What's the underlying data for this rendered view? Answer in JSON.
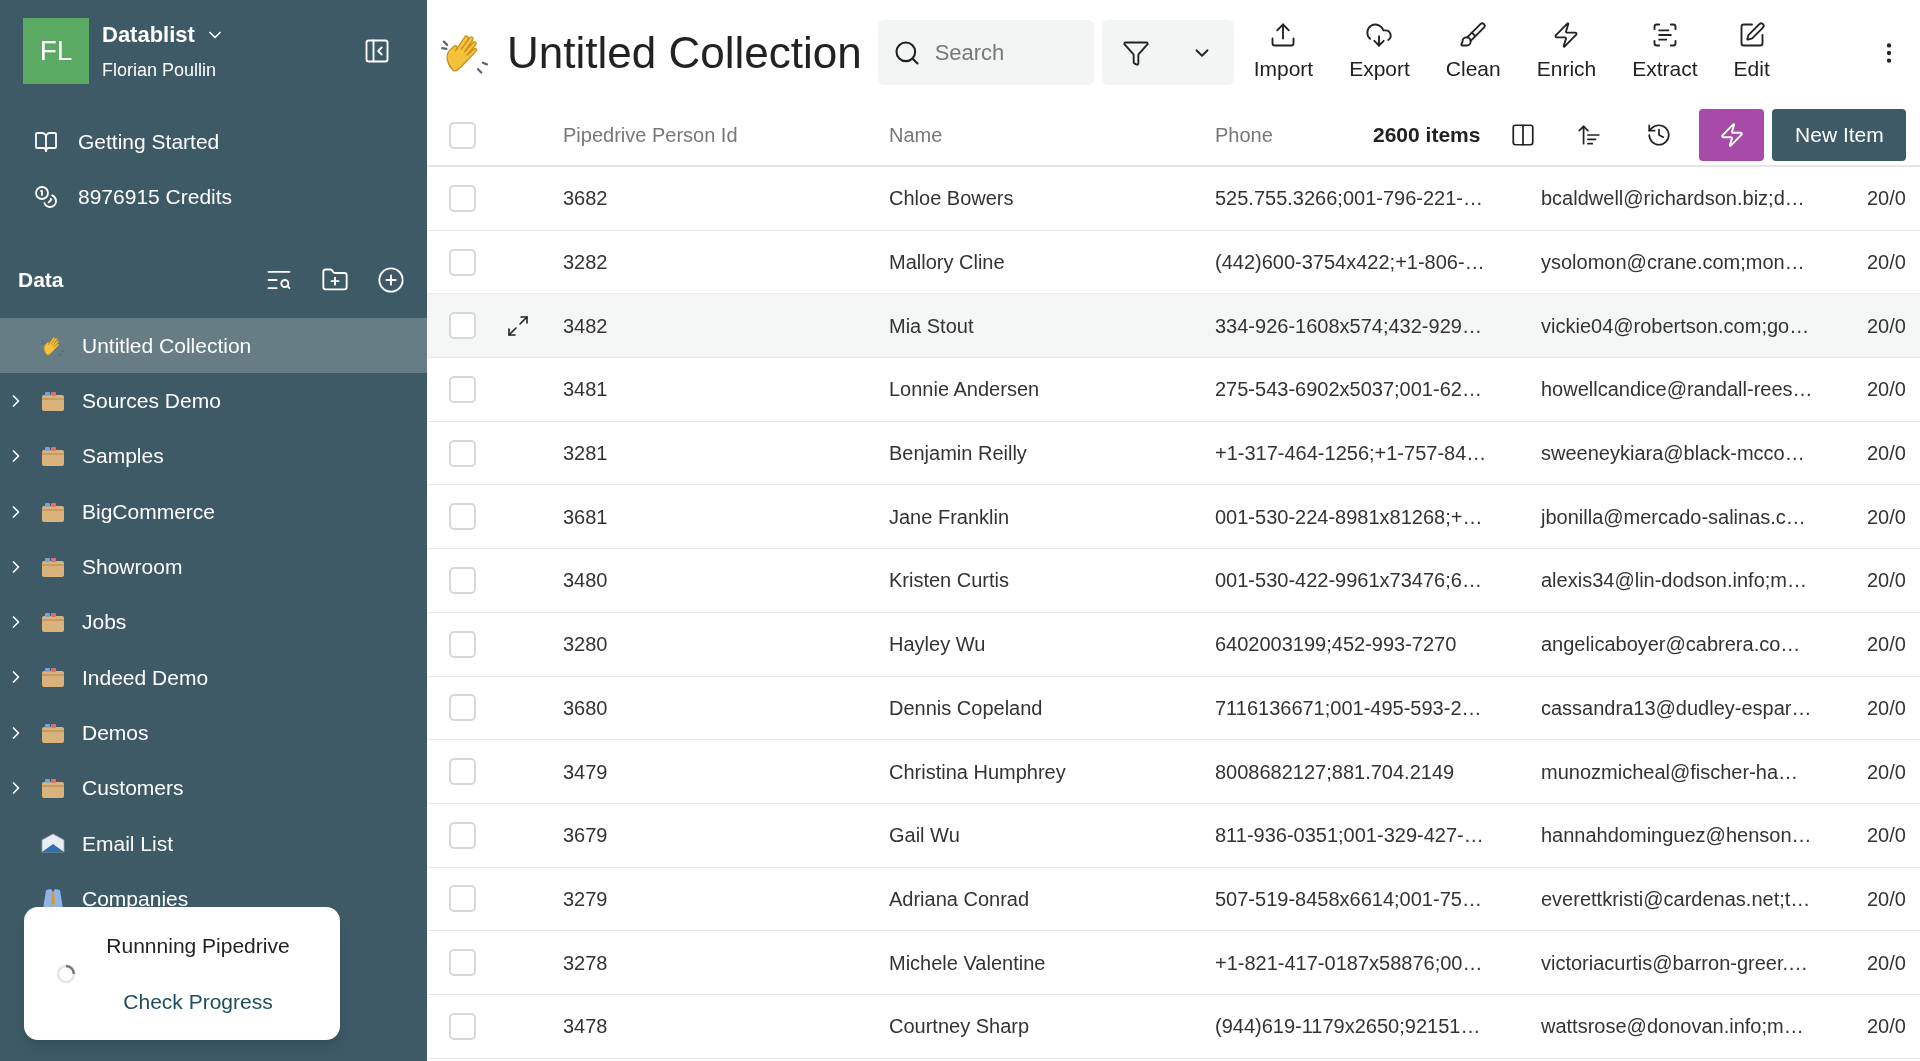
{
  "workspace": {
    "initials": "FL",
    "name": "Datablist",
    "user": "Florian Poullin"
  },
  "sidebar": {
    "links": [
      {
        "label": "Getting Started",
        "kind": "book"
      },
      {
        "label": "8976915 Credits",
        "kind": "coins"
      }
    ],
    "section_title": "Data",
    "items": [
      {
        "label": "Untitled Collection",
        "kind": "wave",
        "selected": true,
        "expandable": false
      },
      {
        "label": "Sources Demo",
        "kind": "folder",
        "selected": false,
        "expandable": true
      },
      {
        "label": "Samples",
        "kind": "folder",
        "selected": false,
        "expandable": true
      },
      {
        "label": "BigCommerce",
        "kind": "folder",
        "selected": false,
        "expandable": true
      },
      {
        "label": "Showroom",
        "kind": "folder",
        "selected": false,
        "expandable": true
      },
      {
        "label": "Jobs",
        "kind": "folder",
        "selected": false,
        "expandable": true
      },
      {
        "label": "Indeed Demo",
        "kind": "folder",
        "selected": false,
        "expandable": true
      },
      {
        "label": "Demos",
        "kind": "folder",
        "selected": false,
        "expandable": true
      },
      {
        "label": "Customers",
        "kind": "folder",
        "selected": false,
        "expandable": true
      },
      {
        "label": "Email List",
        "kind": "mail",
        "selected": false,
        "expandable": false
      },
      {
        "label": "Companies",
        "kind": "tie",
        "selected": false,
        "expandable": false
      }
    ]
  },
  "toast": {
    "title": "Runnning Pipedrive",
    "link": "Check Progress"
  },
  "header": {
    "title": "Untitled Collection",
    "search": {
      "placeholder": "Search"
    },
    "actions": [
      {
        "label": "Import",
        "kind": "import"
      },
      {
        "label": "Export",
        "kind": "export"
      },
      {
        "label": "Clean",
        "kind": "clean"
      },
      {
        "label": "Enrich",
        "kind": "enrich"
      },
      {
        "label": "Extract",
        "kind": "extract"
      },
      {
        "label": "Edit",
        "kind": "edit"
      }
    ]
  },
  "table": {
    "all_checked": false,
    "columns": [
      "Pipedrive Person Id",
      "Name",
      "Phone"
    ],
    "item_count": "2600 items",
    "new_button": "New Item",
    "rows": [
      {
        "checked": false,
        "hovered": false,
        "cells": [
          "3682",
          "Chloe Bowers",
          "525.755.3266;001-796-221-…",
          "bcaldwell@richardson.biz;d…",
          "20/0"
        ]
      },
      {
        "checked": false,
        "hovered": false,
        "cells": [
          "3282",
          "Mallory Cline",
          "(442)600-3754x422;+1-806-…",
          "ysolomon@crane.com;mon…",
          "20/0"
        ]
      },
      {
        "checked": false,
        "hovered": true,
        "cells": [
          "3482",
          "Mia Stout",
          "334-926-1608x574;432-929…",
          "vickie04@robertson.com;go…",
          "20/0"
        ]
      },
      {
        "checked": false,
        "hovered": false,
        "cells": [
          "3481",
          "Lonnie Andersen",
          "275-543-6902x5037;001-62…",
          "howellcandice@randall-rees…",
          "20/0"
        ]
      },
      {
        "checked": false,
        "hovered": false,
        "cells": [
          "3281",
          "Benjamin Reilly",
          "+1-317-464-1256;+1-757-84…",
          "sweeneykiara@black-mcco…",
          "20/0"
        ]
      },
      {
        "checked": false,
        "hovered": false,
        "cells": [
          "3681",
          "Jane Franklin",
          "001-530-224-8981x81268;+…",
          "jbonilla@mercado-salinas.c…",
          "20/0"
        ]
      },
      {
        "checked": false,
        "hovered": false,
        "cells": [
          "3480",
          "Kristen Curtis",
          "001-530-422-9961x73476;6…",
          "alexis34@lin-dodson.info;m…",
          "20/0"
        ]
      },
      {
        "checked": false,
        "hovered": false,
        "cells": [
          "3280",
          "Hayley Wu",
          "6402003199;452-993-7270",
          "angelicaboyer@cabrera.co…",
          "20/0"
        ]
      },
      {
        "checked": false,
        "hovered": false,
        "cells": [
          "3680",
          "Dennis Copeland",
          "7116136671;001-495-593-2…",
          "cassandra13@dudley-espar…",
          "20/0"
        ]
      },
      {
        "checked": false,
        "hovered": false,
        "cells": [
          "3479",
          "Christina Humphrey",
          "8008682127;881.704.2149",
          "munozmicheal@fischer-ha…",
          "20/0"
        ]
      },
      {
        "checked": false,
        "hovered": false,
        "cells": [
          "3679",
          "Gail Wu",
          "811-936-0351;001-329-427-…",
          "hannahdominguez@henson…",
          "20/0"
        ]
      },
      {
        "checked": false,
        "hovered": false,
        "cells": [
          "3279",
          "Adriana Conrad",
          "507-519-8458x6614;001-75…",
          "everettkristi@cardenas.net;t…",
          "20/0"
        ]
      },
      {
        "checked": false,
        "hovered": false,
        "cells": [
          "3278",
          "Michele Valentine",
          "+1-821-417-0187x58876;00…",
          "victoriacurtis@barron-greer.…",
          "20/0"
        ]
      },
      {
        "checked": false,
        "hovered": false,
        "cells": [
          "3478",
          "Courtney Sharp",
          "(944)619-1179x2650;92151…",
          "wattsrose@donovan.info;m…",
          "20/0"
        ]
      }
    ]
  }
}
